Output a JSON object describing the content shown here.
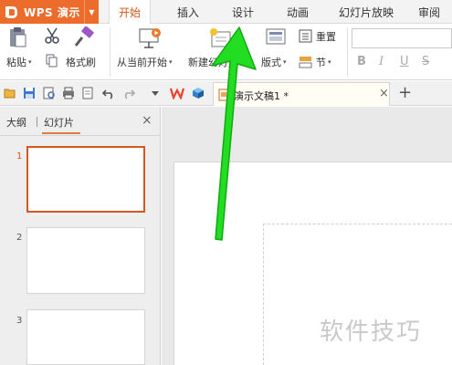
{
  "app": {
    "title": "WPS 演示",
    "menu_caret": "▼"
  },
  "tabs": [
    {
      "label": "开始",
      "active": true
    },
    {
      "label": "插入"
    },
    {
      "label": "设计"
    },
    {
      "label": "动画"
    },
    {
      "label": "幻灯片放映"
    },
    {
      "label": "审阅"
    }
  ],
  "ribbon": {
    "paste": "粘贴",
    "paste_caret": "▾",
    "format_painter": "格式刷",
    "from_current": "从当前开始",
    "from_current_caret": "▾",
    "new_slide": "新建幻灯片",
    "new_slide_caret": "▾",
    "layout": "版式",
    "layout_caret": "▾",
    "reset": "重置",
    "section": "节",
    "section_caret": "▾",
    "bold": "B",
    "italic": "I",
    "underline": "U",
    "strike": "S"
  },
  "document": {
    "tab_label": "演示文稿1 *",
    "close_glyph": "×",
    "new_tab_glyph": "+"
  },
  "left_panel": {
    "outline_tab": "大纲",
    "slides_tab": "幻灯片",
    "close_glyph": "×",
    "slide_numbers": [
      "1",
      "2",
      "3"
    ]
  },
  "watermark": "软件技巧",
  "colors": {
    "accent": "#ec6c2c",
    "active_tab_text": "#d4581e",
    "arrow": "#22dd22"
  },
  "icons": [
    "wps-logo-icon",
    "scissors-icon",
    "paste-icon",
    "format-painter-icon",
    "copy-icon",
    "play-from-current-icon",
    "new-slide-icon",
    "layout-icon",
    "reset-icon",
    "section-icon",
    "open-folder-icon",
    "save-icon",
    "print-preview-icon",
    "print-icon",
    "undo-icon",
    "redo-icon",
    "dropdown-icon",
    "wps-brand-icon",
    "cube-icon",
    "document-icon",
    "arrow-annotation"
  ]
}
